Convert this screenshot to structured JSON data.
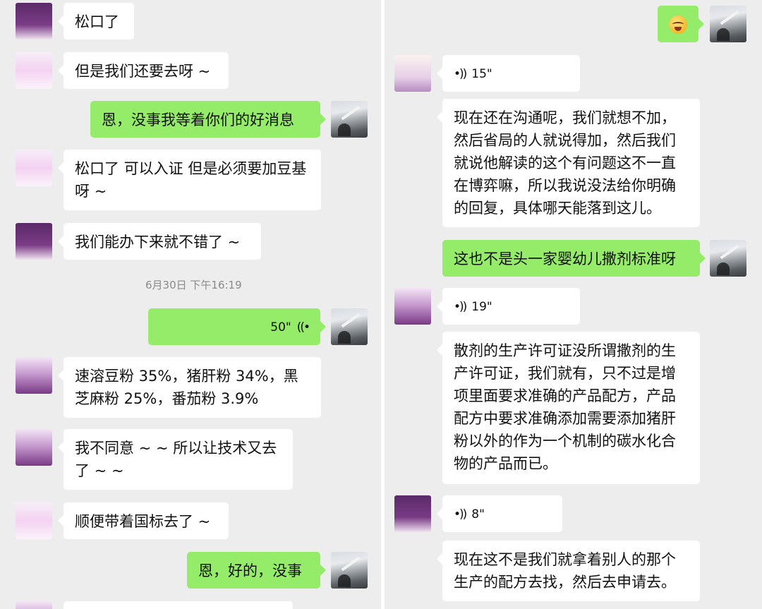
{
  "left": {
    "timestamp": "6月30日 下午16:19",
    "messages": [
      {
        "text": "松口了"
      },
      {
        "text": "但是我们还要去呀 ~"
      },
      {
        "text": "恩，没事我等着你们的好消息"
      },
      {
        "text": "松口了 可以入证  但是必须要加豆基呀 ~"
      },
      {
        "text": "我们能办下来就不错了 ~"
      },
      {
        "duration": "50\"",
        "icon": "voice-wave-icon"
      },
      {
        "text": "速溶豆粉 35%，猪肝粉 34%，黑芝麻粉 25%，番茄粉 3.9%"
      },
      {
        "text": "我不同意 ~ ~ 所以让技术又去了 ~ ~"
      },
      {
        "text": "顺便带着国标去了 ~"
      },
      {
        "text": "恩，好的，没事"
      }
    ]
  },
  "right": {
    "messages": [
      {
        "icon": "laughing-tears-emoji-icon"
      },
      {
        "duration": "15\"",
        "icon": "voice-wave-icon"
      },
      {
        "text": "现在还在沟通呢，我们就想不加，然后省局的人就说得加，然后我们就说他解读的这个有问题这不一直在博弈嘛，所以我说没法给你明确的回复，具体哪天能落到这儿。"
      },
      {
        "text": "这也不是头一家婴幼儿撒剂标准呀"
      },
      {
        "duration": "19\"",
        "icon": "voice-wave-icon"
      },
      {
        "text": "散剂的生产许可证没所谓撒剂的生产许可证，我们就有，只不过是增项里面要求准确的产品配方，产品配方中要求准确添加需要添加猪肝粉以外的作为一个机制的碳水化合物的产品而已。"
      },
      {
        "duration": "8\"",
        "icon": "voice-wave-icon"
      },
      {
        "text": "现在这不是我们就拿着别人的那个生产的配方去找，然后去申请去。"
      }
    ]
  },
  "colors": {
    "background": "#ededed",
    "incoming_bubble": "#ffffff",
    "outgoing_bubble": "#95ec69",
    "timestamp_text": "#8a8a8a"
  }
}
